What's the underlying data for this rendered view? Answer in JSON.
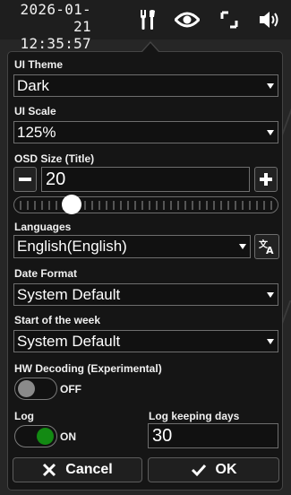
{
  "status": {
    "date": "2026-01-21",
    "time": "12:35:57"
  },
  "toolbar": {
    "icons": [
      "tools-icon",
      "eye-icon",
      "fullscreen-icon",
      "speaker-icon"
    ]
  },
  "settings": {
    "ui_theme": {
      "label": "UI Theme",
      "value": "Dark"
    },
    "ui_scale": {
      "label": "UI Scale",
      "value": "125%"
    },
    "osd_size": {
      "label": "OSD Size (Title)",
      "value": "20",
      "slider_fraction": 0.22
    },
    "languages": {
      "label": "Languages",
      "value": "English(English)"
    },
    "date_format": {
      "label": "Date Format",
      "value": "System Default"
    },
    "week_start": {
      "label": "Start of the week",
      "value": "System Default"
    },
    "hw_decoding": {
      "label": "HW Decoding (Experimental)",
      "state": "OFF"
    },
    "log": {
      "label": "Log",
      "state": "ON"
    },
    "log_days": {
      "label": "Log keeping days",
      "value": "30"
    }
  },
  "actions": {
    "cancel_label": "Cancel",
    "ok_label": "OK"
  },
  "colors": {
    "toggle_on_knob": "#1a8a1a",
    "toggle_off_knob": "#888888",
    "panel_bg": "#151515"
  }
}
